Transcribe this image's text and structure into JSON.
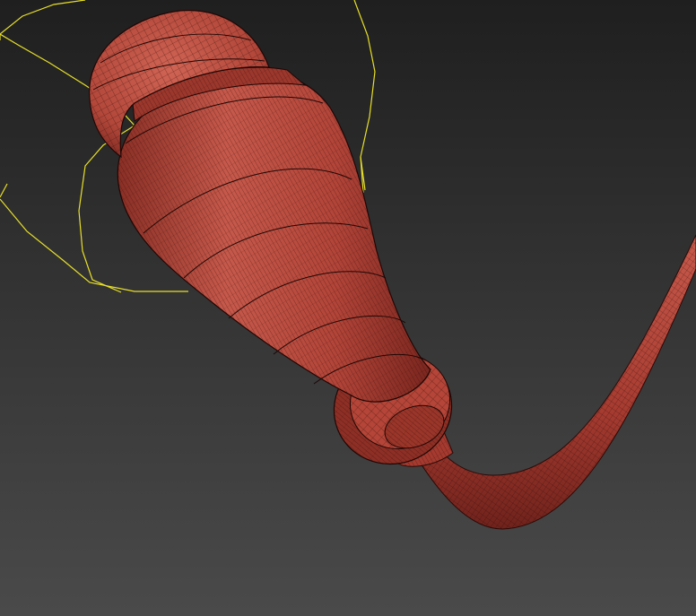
{
  "viewport": {
    "background_top": "#1f1f1f",
    "background_bottom": "#4a4a4a",
    "mesh_color": "#b9493c",
    "mesh_highlight": "#d8685a",
    "mesh_shadow": "#6e231c",
    "wire_color": "#1e0705",
    "selection_color": "#e8e02a"
  },
  "scene": {
    "object_1": "mesh",
    "object_1_parts": [
      "dome-cap",
      "cone-body",
      "collar-ring",
      "curved-tube"
    ],
    "object_2": "spline-selection-outline"
  }
}
